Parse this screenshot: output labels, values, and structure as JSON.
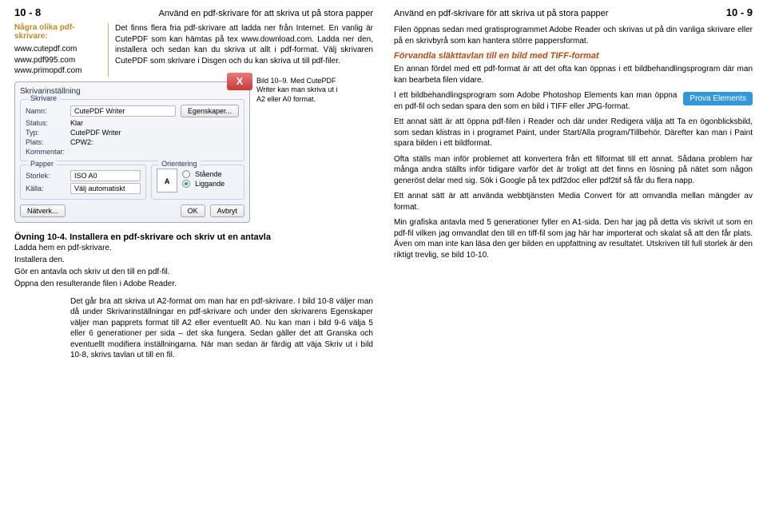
{
  "left": {
    "pgnum": "10 - 8",
    "runhead": "Använd en pdf-skrivare för att skriva ut på stora papper",
    "sidebar": {
      "title": "Några olika pdf-skrivare:",
      "links": [
        "www.cutepdf.com",
        "www.pdf995.com",
        "www.primopdf.com"
      ]
    },
    "intro": "Det finns flera fria pdf-skrivare att ladda ner från Internet. En vanlig är CutePDF som kan hämtas på tex www.download.com. Ladda ner den, installera och sedan kan du skriva ut allt i pdf-format. Välj skrivaren CutePDF som skrivare i Disgen och du kan skriva ut till pdf-filer.",
    "dialog": {
      "title": "Skrivarinställning",
      "close": "X",
      "grp1": "Skrivare",
      "lbl_name": "Namn:",
      "val_name": "CutePDF Writer",
      "btn_props": "Egenskaper...",
      "lbl_status": "Status:",
      "val_status": "Klar",
      "lbl_type": "Typ:",
      "val_type": "CutePDF Writer",
      "lbl_plats": "Plats:",
      "val_plats": "CPW2:",
      "lbl_komm": "Kommentar:",
      "grp2": "Papper",
      "lbl_storlek": "Storlek:",
      "val_storlek": "ISO A0",
      "lbl_kalla": "Källa:",
      "val_kalla": "Välj automatiskt",
      "grp3": "Orientering",
      "opt_staende": "Stående",
      "opt_liggande": "Liggande",
      "letterA": "A",
      "btn_net": "Nätverk...",
      "btn_ok": "OK",
      "btn_cancel": "Avbryt"
    },
    "caption": "Bild 10–9.  Med CutePDF Writer kan man skriva ut i A2 eller A0 format.",
    "ovning": {
      "title": "Övning 10-4.   Installera en pdf-skrivare och skriv ut en antavla",
      "lines": [
        "Ladda hem en pdf-skrivare.",
        "Installera den.",
        "Gör en antavla och skriv ut den till en pdf-fil.",
        "Öppna den resulterande filen i Adobe Reader."
      ]
    },
    "block": "Det går bra att skriva ut A2-format om man har en pdf-skrivare. I bild 10-8 väljer man då under Skrivarinställningar en pdf-skrivare och under den skrivarens Egenskaper väljer man papprets format till A2 eller eventuellt A0. Nu kan man i bild 9-6 välja 5 eller 6 generationer per sida – det ska fungera. Sedan gäller det att Granska och eventuellt modifiera inställningarna. När man sedan är färdig att väja Skriv ut i bild 10-8, skrivs tavlan ut till en fil."
  },
  "right": {
    "runhead": "Använd en pdf-skrivare för att skriva ut på stora papper",
    "pgnum": "10 - 9",
    "p1": "Filen öppnas sedan med gratisprogrammet Adobe Reader och skrivas ut på din vanliga skrivare eller på en skrivbyrå som kan hantera större pappersformat.",
    "subhead": "Förvandla släkttavlan till en bild med TIFF-format",
    "p2": "En annan fördel med ett pdf-format är att det ofta kan öppnas i ett bildbehandlingsprogram där man kan bearbeta filen vidare.",
    "prova": "Prova Elements",
    "p3": "I ett bildbehandlingsprogram som Adobe Photoshop Elements kan man öppna en pdf-fil och sedan spara den som en bild i TIFF eller JPG-format.",
    "p4": "Ett annat sätt är att öppna pdf-filen i Reader och där under Redigera välja att Ta en ögonblicksbild, som sedan klistras in i programet Paint, under Start/Alla program/Tillbehör. Därefter kan man i Paint spara bilden i ett bildformat.",
    "p5": "Ofta ställs man inför problemet att konvertera från ett filformat till ett annat. Sådana problem har många andra ställts inför tidigare varför det är troligt att det finns en lösning på nätet som någon generöst delar med sig. Sök i Google på tex pdf2doc eller pdf2tif så får du flera napp.",
    "p6": "Ett annat sätt är att använda webbtjänsten Media Convert för att omvandla mellan mängder av format.",
    "p7": "Min grafiska antavla med 5 generationer fyller en A1-sida. Den har jag på detta vis skrivit ut som en pdf-fil vilken jag omvandlat den till en tiff-fil som jag här har importerat och skalat så att den får plats. Även om man inte kan läsa den ger bilden en uppfattning av resultatet. Utskriven till full storlek är den riktigt trevlig, se bild 10-10."
  }
}
